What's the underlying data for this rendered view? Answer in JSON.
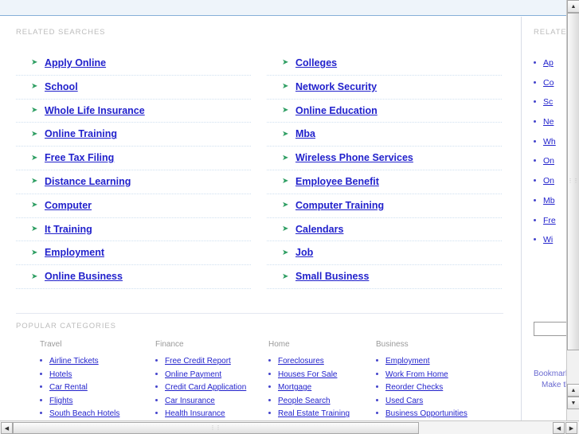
{
  "related": {
    "heading": "RELATED SEARCHES",
    "columns": [
      {
        "items": [
          "Apply Online",
          "School",
          "Whole Life Insurance",
          "Online Training",
          "Free Tax Filing",
          "Distance Learning",
          "Computer",
          "It Training",
          "Employment",
          "Online Business"
        ]
      },
      {
        "items": [
          "Colleges",
          "Network Security",
          "Online Education",
          "Mba",
          "Wireless Phone Services",
          "Employee Benefit",
          "Computer Training",
          "Calendars",
          "Job",
          "Small Business"
        ]
      }
    ],
    "bullet_icon": "arrow-bullet-icon",
    "link_color": "#2222cc",
    "arrow_color": "#2e9e62"
  },
  "popular": {
    "heading": "POPULAR CATEGORIES",
    "categories": [
      {
        "title": "Travel",
        "items": [
          "Airline Tickets",
          "Hotels",
          "Car Rental",
          "Flights",
          "South Beach Hotels"
        ]
      },
      {
        "title": "Finance",
        "items": [
          "Free Credit Report",
          "Online Payment",
          "Credit Card Application",
          "Car Insurance",
          "Health Insurance"
        ]
      },
      {
        "title": "Home",
        "items": [
          "Foreclosures",
          "Houses For Sale",
          "Mortgage",
          "People Search",
          "Real Estate Training"
        ]
      },
      {
        "title": "Business",
        "items": [
          "Employment",
          "Work From Home",
          "Reorder Checks",
          "Used Cars",
          "Business Opportunities"
        ]
      }
    ]
  },
  "sidebar": {
    "heading": "RELATED",
    "items": [
      "Ap",
      "Co",
      "Sc",
      "Ne",
      "Wh",
      "On",
      "On",
      "Mb",
      "Fre",
      "Wi"
    ],
    "search_value": "",
    "search_placeholder": "",
    "footer_links": [
      "Bookmark",
      "Make this"
    ]
  },
  "scrollbars": {
    "up_arrow": "▲",
    "down_arrow": "▼",
    "left_arrow": "◀",
    "right_arrow": "▶",
    "grip": "⋮⋮"
  }
}
